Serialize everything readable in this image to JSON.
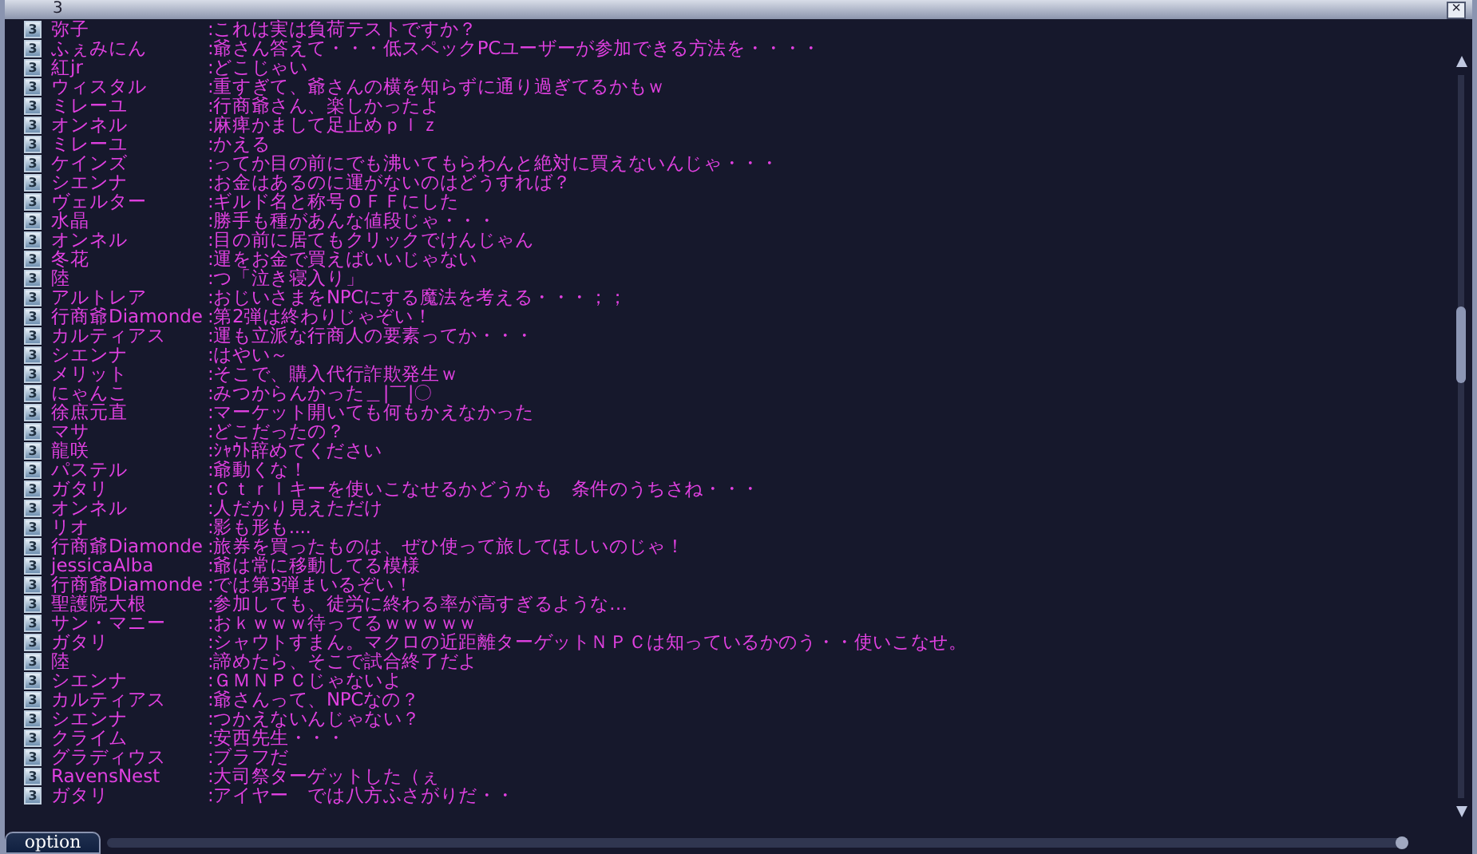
{
  "window": {
    "title": "3",
    "close": "×"
  },
  "messages": [
    {
      "badge": "3",
      "name": "弥子",
      "text": ":これは実は負荷テストですか？"
    },
    {
      "badge": "3",
      "name": "ふぇみにん",
      "text": ":爺さん答えて・・・低スペックPCユーザーが参加できる方法を・・・・"
    },
    {
      "badge": "3",
      "name": "紅jr",
      "text": ":どこじゃい"
    },
    {
      "badge": "3",
      "name": "ウィスタル",
      "text": ":重すぎて、爺さんの横を知らずに通り過ぎてるかもｗ"
    },
    {
      "badge": "3",
      "name": "ミレーユ",
      "text": ":行商爺さん、楽しかったよ"
    },
    {
      "badge": "3",
      "name": "オンネル",
      "text": ":麻痺かまして足止めｐｌｚ"
    },
    {
      "badge": "3",
      "name": "ミレーユ",
      "text": ":かえる"
    },
    {
      "badge": "3",
      "name": "ケインズ",
      "text": ":ってか目の前にでも沸いてもらわんと絶対に買えないんじゃ・・・"
    },
    {
      "badge": "3",
      "name": "シエンナ",
      "text": ":お金はあるのに運がないのはどうすれば？"
    },
    {
      "badge": "3",
      "name": "ヴェルター",
      "text": ":ギルド名と称号ＯＦＦにした"
    },
    {
      "badge": "3",
      "name": "水晶",
      "text": ":勝手も種があんな値段じゃ・・・"
    },
    {
      "badge": "3",
      "name": "オンネル",
      "text": ":目の前に居てもクリックでけんじゃん"
    },
    {
      "badge": "3",
      "name": "冬花",
      "text": ":運をお金で買えばいいじゃない"
    },
    {
      "badge": "3",
      "name": "陸",
      "text": ":つ「泣き寝入り」"
    },
    {
      "badge": "3",
      "name": "アルトレア",
      "text": ":おじいさまをNPCにする魔法を考える・・・；；"
    },
    {
      "badge": "3",
      "name": "行商爺Diamonde",
      "text": ":第2弾は終わりじゃぞい！"
    },
    {
      "badge": "3",
      "name": "カルティアス",
      "text": ":運も立派な行商人の要素ってか・・・"
    },
    {
      "badge": "3",
      "name": "シエンナ",
      "text": ":はやい～"
    },
    {
      "badge": "3",
      "name": "メリット",
      "text": ":そこで、購入代行詐欺発生ｗ"
    },
    {
      "badge": "3",
      "name": "にゃんこ",
      "text": ":みつからんかった＿|￣|〇"
    },
    {
      "badge": "3",
      "name": "徐庶元直",
      "text": ":マーケット開いても何もかえなかった"
    },
    {
      "badge": "3",
      "name": "マサ",
      "text": ":どこだったの？"
    },
    {
      "badge": "3",
      "name": "龍咲",
      "text": ":ｼｬｳﾄ辞めてください"
    },
    {
      "badge": "3",
      "name": "パステル",
      "text": ":爺動くな！"
    },
    {
      "badge": "3",
      "name": "ガタリ",
      "text": ":Ｃｔｒｌキーを使いこなせるかどうかも　条件のうちさね・・・"
    },
    {
      "badge": "3",
      "name": "オンネル",
      "text": ":人だかり見えただけ"
    },
    {
      "badge": "3",
      "name": "リオ",
      "text": ":影も形も...."
    },
    {
      "badge": "3",
      "name": "行商爺Diamonde",
      "text": ":旅券を買ったものは、ぜひ使って旅してほしいのじゃ！"
    },
    {
      "badge": "3",
      "name": "jessicaAlba",
      "text": ":爺は常に移動してる模様"
    },
    {
      "badge": "3",
      "name": "行商爺Diamonde",
      "text": ":では第3弾まいるぞい！"
    },
    {
      "badge": "3",
      "name": "聖護院大根",
      "text": ":参加しても、徒労に終わる率が高すぎるような…"
    },
    {
      "badge": "3",
      "name": "サン・マニー",
      "text": ":おｋｗｗｗ待ってるｗｗｗｗｗ"
    },
    {
      "badge": "3",
      "name": "ガタリ",
      "text": ":シャウトすまん。マクロの近距離ターゲットＮＰＣは知っているかのう・・使いこなせ。"
    },
    {
      "badge": "3",
      "name": "陸",
      "text": ":諦めたら、そこで試合終了だよ"
    },
    {
      "badge": "3",
      "name": "シエンナ",
      "text": ":ＧＭＮＰＣじゃないよ"
    },
    {
      "badge": "3",
      "name": "カルティアス",
      "text": ":爺さんって、NPCなの？"
    },
    {
      "badge": "3",
      "name": "シエンナ",
      "text": ":つかえないんじゃない？"
    },
    {
      "badge": "3",
      "name": "クライム",
      "text": ":安西先生・・・"
    },
    {
      "badge": "3",
      "name": "グラディウス",
      "text": ":ブラフだ"
    },
    {
      "badge": "3",
      "name": "RavensNest",
      "text": ":大司祭ターゲットした（ぇ"
    },
    {
      "badge": "3",
      "name": "ガタリ",
      "text": ":アイヤー　では八方ふさがりだ・・"
    }
  ],
  "bottom_tab": {
    "label": "option",
    "selected": true
  }
}
